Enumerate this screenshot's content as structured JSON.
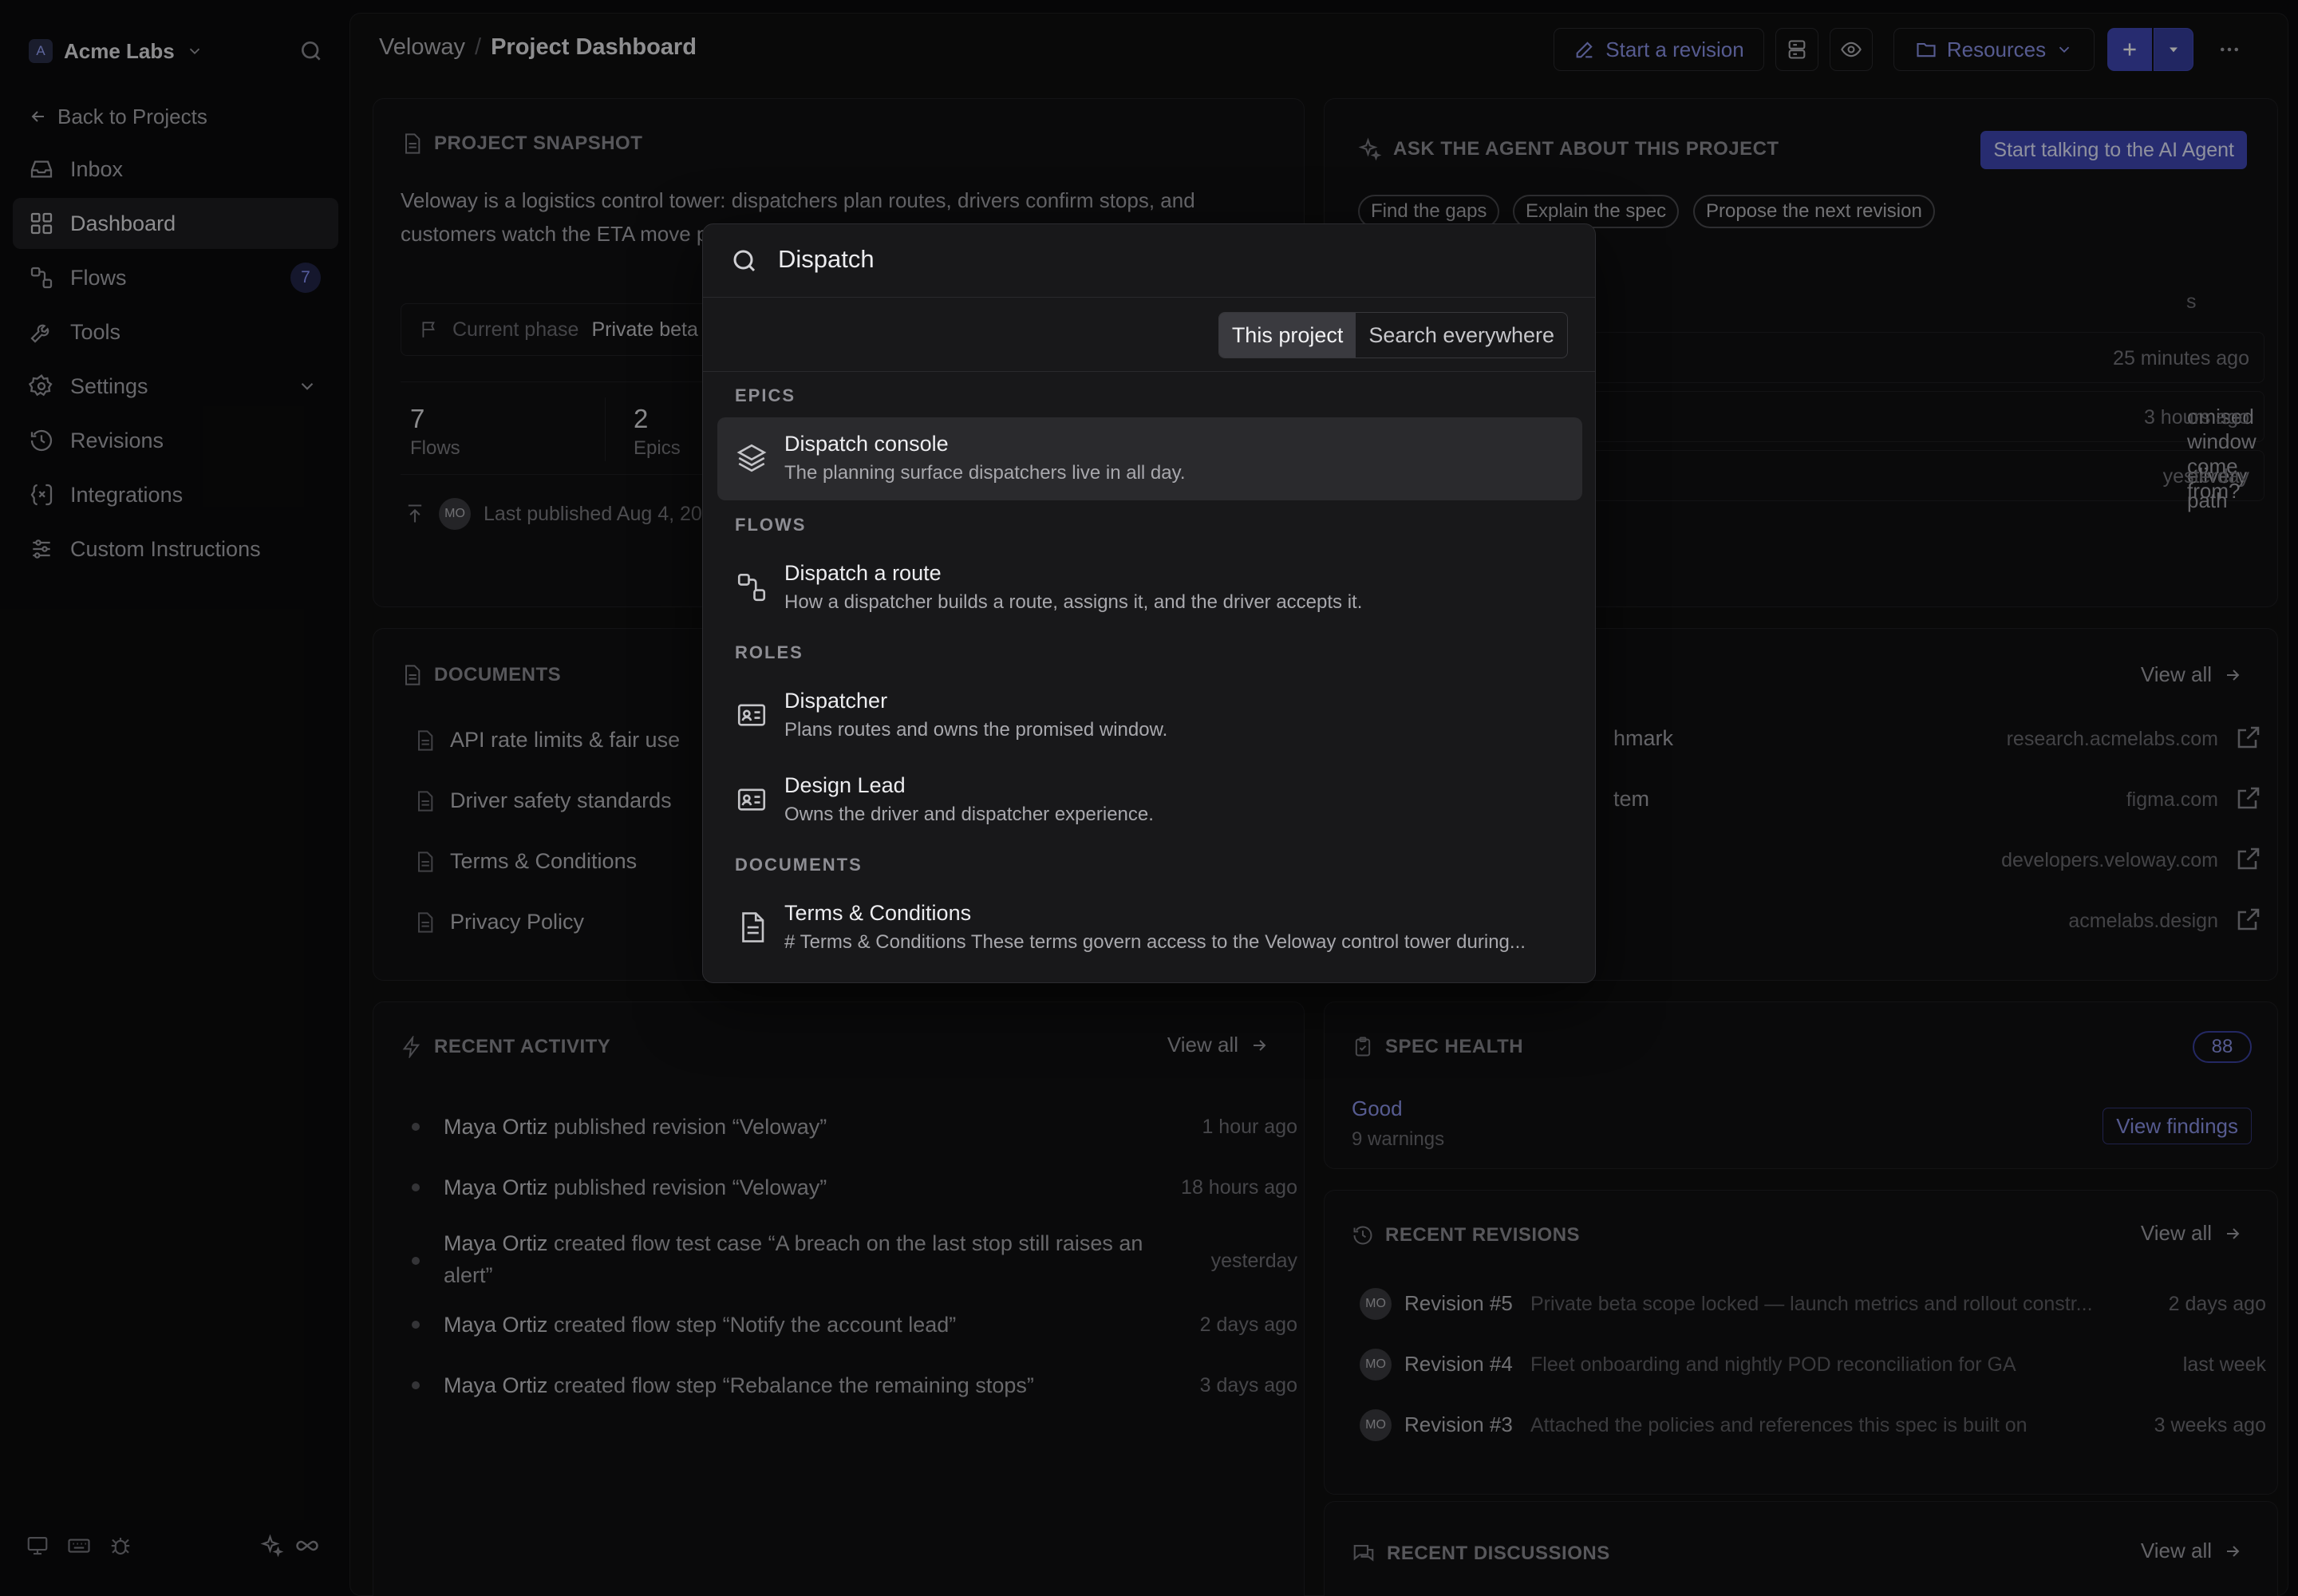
{
  "sidebar": {
    "workspace_initial": "A",
    "workspace_name": "Acme Labs",
    "back_label": "Back to Projects",
    "items": [
      {
        "label": "Inbox",
        "icon": "inbox-icon"
      },
      {
        "label": "Dashboard",
        "icon": "grid-icon",
        "active": true
      },
      {
        "label": "Flows",
        "icon": "flow-icon",
        "badge": "7"
      },
      {
        "label": "Tools",
        "icon": "wrench-icon"
      },
      {
        "label": "Settings",
        "icon": "gear-icon"
      },
      {
        "label": "Revisions",
        "icon": "history-icon"
      },
      {
        "label": "Integrations",
        "icon": "integrations-icon"
      },
      {
        "label": "Custom Instructions",
        "icon": "sliders-icon"
      }
    ]
  },
  "breadcrumb": {
    "project": "Veloway",
    "separator": "/",
    "page": "Project Dashboard"
  },
  "toolbar": {
    "start_revision": "Start a revision",
    "resources": "Resources"
  },
  "snapshot": {
    "title": "PROJECT SNAPSHOT",
    "text": "Veloway is a logistics control tower: dispatchers plan routes, drivers confirm stops, and customers watch the ETA move private beta and the metrics we",
    "phase_label": "Current phase",
    "phase_value": "Private beta",
    "stats": [
      {
        "value": "7",
        "label": "Flows"
      },
      {
        "value": "2",
        "label": "Epics"
      }
    ],
    "publish_avatar": "MO",
    "published": "Last published Aug 4, 20"
  },
  "documents": {
    "title": "DOCUMENTS",
    "items": [
      "API rate limits & fair use",
      "Driver safety standards",
      "Terms & Conditions",
      "Privacy Policy"
    ]
  },
  "activity": {
    "title": "RECENT ACTIVITY",
    "view_all": "View all",
    "items": [
      {
        "actor": "Maya Ortiz",
        "text": " published revision “Veloway”",
        "time": "1 hour ago"
      },
      {
        "actor": "Maya Ortiz",
        "text": " published revision “Veloway”",
        "time": "18 hours ago"
      },
      {
        "actor": "Maya Ortiz",
        "text": " created flow test case “A breach on the last stop still raises an alert”",
        "time": "yesterday"
      },
      {
        "actor": "Maya Ortiz",
        "text": " created flow step “Notify the account lead”",
        "time": "2 days ago"
      },
      {
        "actor": "Maya Ortiz",
        "text": " created flow step “Rebalance the remaining stops”",
        "time": "3 days ago"
      }
    ]
  },
  "agent": {
    "title": "ASK THE AGENT ABOUT THIS PROJECT",
    "cta": "Start talking to the AI Agent",
    "chips": [
      "Find the gaps",
      "Explain the spec",
      "Propose the next revision"
    ],
    "partial_label": "s",
    "questions": [
      {
        "text": "",
        "time": "25 minutes ago"
      },
      {
        "text": "omised window come from?",
        "time": "3 hours ago"
      },
      {
        "text": "elivery path",
        "time": "yesterday"
      }
    ]
  },
  "resources": {
    "view_all": "View all",
    "items": [
      {
        "name": "hmark",
        "domain": "research.acmelabs.com"
      },
      {
        "name": "tem",
        "domain": "figma.com"
      },
      {
        "name": "",
        "domain": "developers.veloway.com"
      },
      {
        "name": "",
        "domain": "acmelabs.design"
      }
    ]
  },
  "spec_health": {
    "title": "SPEC HEALTH",
    "score": "88",
    "status": "Good",
    "warnings": "9 warnings",
    "action": "View findings"
  },
  "revisions": {
    "title": "RECENT REVISIONS",
    "view_all": "View all",
    "items": [
      {
        "avatar": "MO",
        "name": "Revision #5",
        "desc": "Private beta scope locked — launch metrics and rollout constr...",
        "time": "2 days ago"
      },
      {
        "avatar": "MO",
        "name": "Revision #4",
        "desc": "Fleet onboarding and nightly POD reconciliation for GA",
        "time": "last week"
      },
      {
        "avatar": "MO",
        "name": "Revision #3",
        "desc": "Attached the policies and references this spec is built on",
        "time": "3 weeks ago"
      }
    ]
  },
  "discussions": {
    "title": "RECENT DISCUSSIONS",
    "view_all": "View all"
  },
  "palette": {
    "query": "Dispatch",
    "scope_active": "This project",
    "scope_other": "Search everywhere",
    "sections": [
      {
        "label": "EPICS",
        "results": [
          {
            "title": "Dispatch console",
            "subtitle": "The planning surface dispatchers live in all day.",
            "icon": "layers-icon",
            "selected": true
          }
        ]
      },
      {
        "label": "FLOWS",
        "results": [
          {
            "title": "Dispatch a route",
            "subtitle": "How a dispatcher builds a route, assigns it, and the driver accepts it.",
            "icon": "flow-icon"
          }
        ]
      },
      {
        "label": "ROLES",
        "results": [
          {
            "title": "Dispatcher",
            "subtitle": "Plans routes and owns the promised window.",
            "icon": "id-card-icon"
          },
          {
            "title": "Design Lead",
            "subtitle": "Owns the driver and dispatcher experience.",
            "icon": "id-card-icon"
          }
        ]
      },
      {
        "label": "DOCUMENTS",
        "results": [
          {
            "title": "Terms & Conditions",
            "subtitle": "# Terms & Conditions These terms govern access to the Veloway control tower during...",
            "icon": "document-icon"
          }
        ]
      }
    ]
  },
  "colors": {
    "accent": "#3f48b5",
    "link": "#8b93e8",
    "background": "#0b0b0c"
  }
}
